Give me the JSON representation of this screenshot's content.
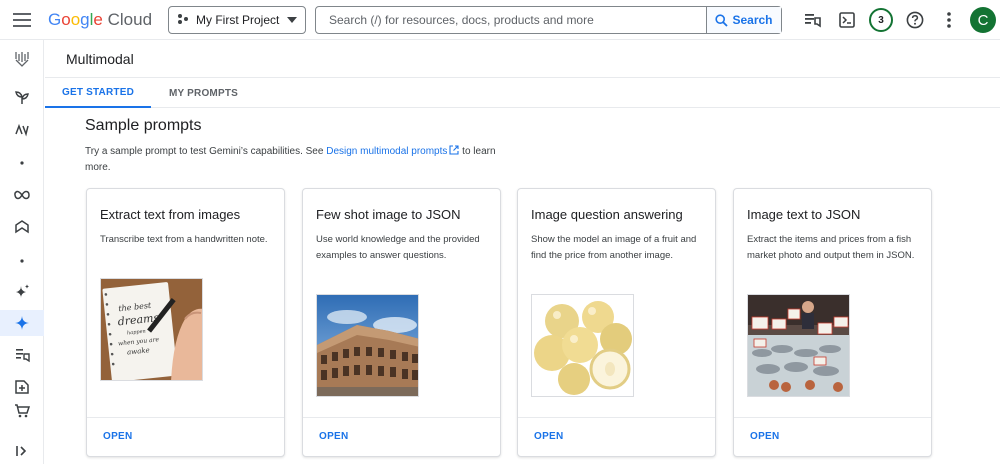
{
  "topbar": {
    "logo_letters": [
      "G",
      "o",
      "o",
      "g",
      "l",
      "e"
    ],
    "logo_suffix": "Cloud",
    "project": "My First Project",
    "search_placeholder": "Search (/) for resources, docs, products and more",
    "search_button": "Search",
    "notifications_count": "3",
    "avatar_initial": "C"
  },
  "page": {
    "title": "Multimodal",
    "tabs": [
      "GET STARTED",
      "MY PROMPTS"
    ]
  },
  "main": {
    "heading": "Sample prompts",
    "desc_before": "Try a sample prompt to test Gemini’s capabilities. See ",
    "desc_link": "Design multimodal prompts",
    "desc_after": " to learn more."
  },
  "cards": [
    {
      "title": "Extract text from images",
      "desc": "Transcribe text from a handwritten note.",
      "open": "OPEN",
      "image": "handwritten-note-image",
      "handwriting": [
        "the best",
        "dreams",
        "happen",
        "when you are",
        "awake"
      ]
    },
    {
      "title": "Few shot image to JSON",
      "desc": "Use world knowledge and the provided examples to answer questions.",
      "open": "OPEN",
      "image": "colosseum-image"
    },
    {
      "title": "Image question answering",
      "desc": "Show the model an image of a fruit and find the price from another image.",
      "open": "OPEN",
      "image": "asian-pears-image"
    },
    {
      "title": "Image text to JSON",
      "desc": "Extract the items and prices from a fish market photo and output them in JSON.",
      "open": "OPEN",
      "image": "fish-market-image"
    }
  ],
  "colors": {
    "accent": "#1a73e8",
    "avatar": "#137333"
  }
}
